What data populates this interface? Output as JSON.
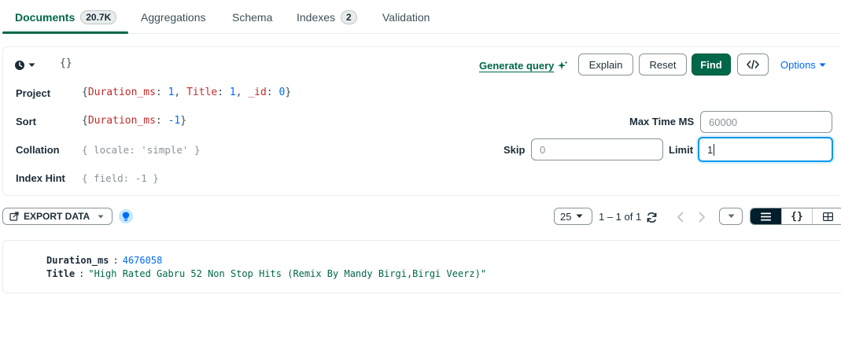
{
  "tabs": [
    {
      "label": "Documents",
      "badge": "20.7K"
    },
    {
      "label": "Aggregations"
    },
    {
      "label": "Schema"
    },
    {
      "label": "Indexes",
      "badge": "2"
    },
    {
      "label": "Validation"
    }
  ],
  "query": {
    "filter": "{}",
    "generate_query": "Generate query",
    "buttons": {
      "explain": "Explain",
      "reset": "Reset",
      "find": "Find",
      "options": "Options"
    },
    "project_label": "Project",
    "project": {
      "open": "{",
      "k1": "Duration_ms",
      "v1": "1",
      "k2": "Title",
      "v2": "1",
      "k3": "_id",
      "v3": "0",
      "close": "}"
    },
    "sort_label": "Sort",
    "sort": {
      "open": "{",
      "k1": "Duration_ms",
      "v1": "-1",
      "close": "}"
    },
    "collation_label": "Collation",
    "collation_placeholder": "{ locale: 'simple' }",
    "index_hint_label": "Index Hint",
    "index_hint_placeholder": "{ field: -1 }",
    "max_time_label": "Max Time MS",
    "max_time_placeholder": "60000",
    "skip_label": "Skip",
    "skip_placeholder": "0",
    "limit_label": "Limit",
    "limit_value": "1"
  },
  "toolbar": {
    "export_label": "EXPORT DATA",
    "page_size": "25",
    "range": "1 – 1 of 1",
    "views": {
      "list": "≡",
      "json": "{}",
      "table": "⊞"
    }
  },
  "document": {
    "fields": [
      {
        "key": "Duration_ms",
        "value": "4676058",
        "type": "number"
      },
      {
        "key": "Title",
        "value": "\"High Rated Gabru 52 Non Stop Hits (Remix By Mandy Birgi,Birgi Veerz)\"",
        "type": "string"
      }
    ]
  },
  "colors": {
    "accent": "#00684a",
    "link": "#016bf8",
    "focus": "#0498ec"
  }
}
